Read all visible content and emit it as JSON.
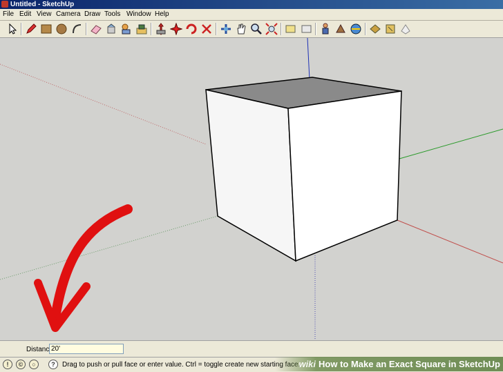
{
  "window": {
    "title": "Untitled - SketchUp"
  },
  "menu": {
    "items": [
      "File",
      "Edit",
      "View",
      "Camera",
      "Draw",
      "Tools",
      "Window",
      "Help"
    ]
  },
  "toolbar": {
    "tools": [
      "select-icon",
      "pencil-icon",
      "rectangle-icon",
      "circle-icon",
      "arc-icon",
      "eraser-icon",
      "paint-bucket-icon",
      "make-component-icon",
      "push-pull-icon",
      "move-icon",
      "rotate-icon",
      "offset-icon",
      "orbit-icon",
      "pan-icon",
      "zoom-icon",
      "zoom-extents-icon",
      "previous-view-icon",
      "next-view-icon",
      "walk-icon",
      "look-around-icon",
      "position-camera-icon",
      "tape-measure-icon",
      "dimensions-icon",
      "protractor-icon",
      "text-icon"
    ]
  },
  "vcb": {
    "label": "Distance",
    "value": "20'"
  },
  "status": {
    "message": "Drag to push or pull face or enter value.  Ctrl = toggle create new starting face.",
    "icons": [
      "geo-location-icon",
      "credits-icon",
      "help-icon"
    ]
  },
  "watermark": {
    "site": "wiki",
    "text": "How to Make an Exact Square in SketchUp"
  },
  "colors": {
    "axis_red": "#c0504d",
    "axis_green": "#2a9a2a",
    "axis_blue": "#1c2fb5",
    "annotation_arrow": "#e01010"
  }
}
